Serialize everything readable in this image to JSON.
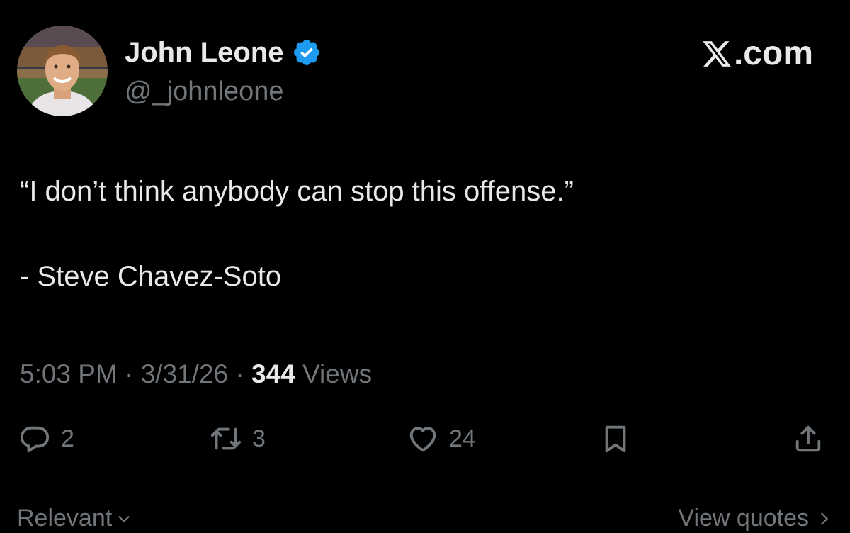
{
  "colors": {
    "background": "#000000",
    "primary_text": "#e7e9ea",
    "secondary_text": "#71767b",
    "verified_badge": "#1d9bf0"
  },
  "author": {
    "display_name": "John Leone",
    "handle": "@_johnleone",
    "verified": true,
    "avatar_icon": "profile-photo"
  },
  "brand": {
    "label": ".com",
    "icon": "x-logo-icon"
  },
  "tweet": {
    "lines": [
      "“I don’t think anybody can stop this offense.”",
      "",
      "- Steve Chavez-Soto"
    ]
  },
  "meta": {
    "time": "5:03 PM",
    "separator": " · ",
    "date": "3/31/26",
    "views_count": "344",
    "views_label": " Views"
  },
  "actions": {
    "reply": {
      "icon": "reply-icon",
      "count": "2"
    },
    "retweet": {
      "icon": "retweet-icon",
      "count": "3"
    },
    "like": {
      "icon": "heart-icon",
      "count": "24"
    },
    "bookmark": {
      "icon": "bookmark-icon"
    },
    "share": {
      "icon": "share-icon"
    }
  },
  "footer": {
    "sort_label": "Relevant",
    "view_quotes_label": "View quotes"
  }
}
